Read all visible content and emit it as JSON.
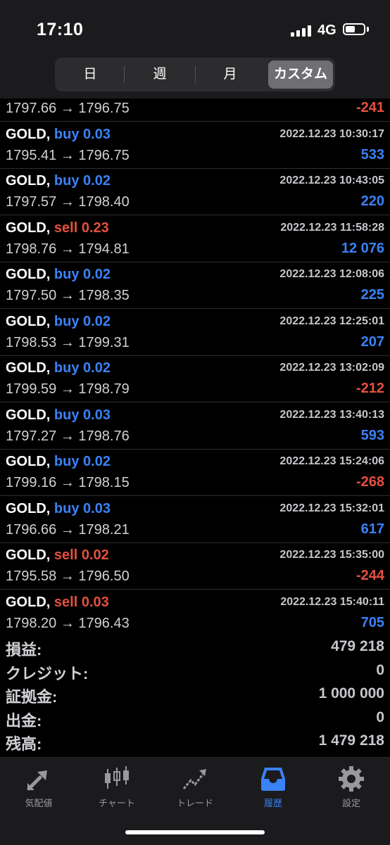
{
  "status": {
    "time": "17:10",
    "network": "4G"
  },
  "tabs": {
    "day": "日",
    "week": "週",
    "month": "月",
    "custom": "カスタム"
  },
  "trades": [
    {
      "symbol": "",
      "side": "",
      "side_type": "",
      "lot": "",
      "datetime": "",
      "prices": "1797.66 → 1796.75",
      "profit": "-241",
      "profit_sign": "neg"
    },
    {
      "symbol": "GOLD,",
      "side": "buy",
      "side_type": "buy",
      "lot": "0.03",
      "datetime": "2022.12.23 10:30:17",
      "prices": "1795.41 → 1796.75",
      "profit": "533",
      "profit_sign": "pos"
    },
    {
      "symbol": "GOLD,",
      "side": "buy",
      "side_type": "buy",
      "lot": "0.02",
      "datetime": "2022.12.23 10:43:05",
      "prices": "1797.57 → 1798.40",
      "profit": "220",
      "profit_sign": "pos"
    },
    {
      "symbol": "GOLD,",
      "side": "sell",
      "side_type": "sell",
      "lot": "0.23",
      "datetime": "2022.12.23 11:58:28",
      "prices": "1798.76 → 1794.81",
      "profit": "12 076",
      "profit_sign": "pos"
    },
    {
      "symbol": "GOLD,",
      "side": "buy",
      "side_type": "buy",
      "lot": "0.02",
      "datetime": "2022.12.23 12:08:06",
      "prices": "1797.50 → 1798.35",
      "profit": "225",
      "profit_sign": "pos"
    },
    {
      "symbol": "GOLD,",
      "side": "buy",
      "side_type": "buy",
      "lot": "0.02",
      "datetime": "2022.12.23 12:25:01",
      "prices": "1798.53 → 1799.31",
      "profit": "207",
      "profit_sign": "pos"
    },
    {
      "symbol": "GOLD,",
      "side": "buy",
      "side_type": "buy",
      "lot": "0.02",
      "datetime": "2022.12.23 13:02:09",
      "prices": "1799.59 → 1798.79",
      "profit": "-212",
      "profit_sign": "neg"
    },
    {
      "symbol": "GOLD,",
      "side": "buy",
      "side_type": "buy",
      "lot": "0.03",
      "datetime": "2022.12.23 13:40:13",
      "prices": "1797.27 → 1798.76",
      "profit": "593",
      "profit_sign": "pos"
    },
    {
      "symbol": "GOLD,",
      "side": "buy",
      "side_type": "buy",
      "lot": "0.02",
      "datetime": "2022.12.23 15:24:06",
      "prices": "1799.16 → 1798.15",
      "profit": "-268",
      "profit_sign": "neg"
    },
    {
      "symbol": "GOLD,",
      "side": "buy",
      "side_type": "buy",
      "lot": "0.03",
      "datetime": "2022.12.23 15:32:01",
      "prices": "1796.66 → 1798.21",
      "profit": "617",
      "profit_sign": "pos"
    },
    {
      "symbol": "GOLD,",
      "side": "sell",
      "side_type": "sell",
      "lot": "0.02",
      "datetime": "2022.12.23 15:35:00",
      "prices": "1795.58 → 1796.50",
      "profit": "-244",
      "profit_sign": "neg"
    },
    {
      "symbol": "GOLD,",
      "side": "sell",
      "side_type": "sell",
      "lot": "0.03",
      "datetime": "2022.12.23 15:40:11",
      "prices": "1798.20 → 1796.43",
      "profit": "705",
      "profit_sign": "pos"
    }
  ],
  "summary": [
    {
      "label": "損益:",
      "value": "479 218"
    },
    {
      "label": "クレジット:",
      "value": "0"
    },
    {
      "label": "証拠金:",
      "value": "1 000 000"
    },
    {
      "label": "出金:",
      "value": "0"
    },
    {
      "label": "残高:",
      "value": "1 479 218"
    }
  ],
  "tabbar": [
    {
      "label": "気配値",
      "icon": "quotes-icon"
    },
    {
      "label": "チャート",
      "icon": "chart-icon"
    },
    {
      "label": "トレード",
      "icon": "trade-icon"
    },
    {
      "label": "履歴",
      "icon": "history-icon",
      "active": true
    },
    {
      "label": "設定",
      "icon": "settings-icon"
    }
  ],
  "colors": {
    "buy": "#3a82f7",
    "sell": "#e5503f",
    "active_tab": "#3a82f7"
  }
}
